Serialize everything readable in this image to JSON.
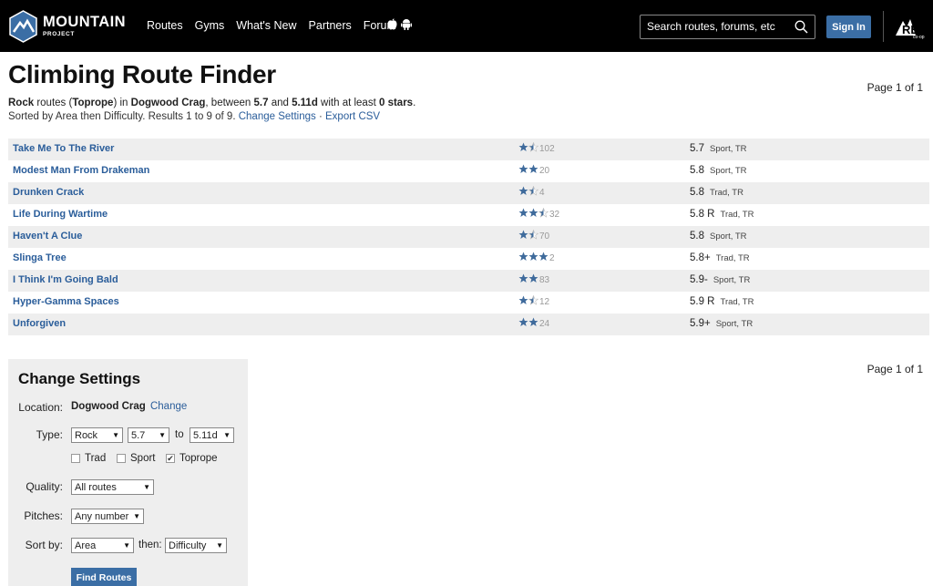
{
  "header": {
    "logo_text": "MOUNTAIN",
    "logo_subtext": "PROJECT",
    "nav": [
      "Routes",
      "Gyms",
      "What's New",
      "Partners",
      "Forum"
    ],
    "search_placeholder": "Search routes, forums, etc",
    "signin_label": "Sign In",
    "partner_logo_text": "REI",
    "partner_logo_sub": "co-op"
  },
  "page": {
    "title": "Climbing Route Finder",
    "page_count_top": "Page 1 of 1",
    "page_count_bottom": "Page 1 of 1",
    "criteria": {
      "type": "Rock",
      "t1": " routes (",
      "style": "Toprope",
      "t2": ") in ",
      "area": "Dogwood Crag",
      "t3": ", between ",
      "grade_min": "5.7",
      "t4": " and ",
      "grade_max": "5.11d",
      "t5": " with at least ",
      "stars": "0 stars",
      "t6": "."
    },
    "sort_text": "Sorted by Area then Difficulty. Results 1 to 9 of 9.",
    "change_settings_link": "Change Settings",
    "separator": "·",
    "export_link": "Export CSV"
  },
  "routes": [
    {
      "name": "Take Me To The River",
      "stars": 1.5,
      "votes": "102",
      "grade": "5.7",
      "type": "Sport, TR"
    },
    {
      "name": "Modest Man From Drakeman",
      "stars": 2,
      "votes": "20",
      "grade": "5.8",
      "type": "Sport, TR"
    },
    {
      "name": "Drunken Crack",
      "stars": 1.5,
      "votes": "4",
      "grade": "5.8",
      "type": "Trad, TR"
    },
    {
      "name": "Life During Wartime",
      "stars": 2.5,
      "votes": "32",
      "grade": "5.8 R",
      "type": "Trad, TR"
    },
    {
      "name": "Haven't A Clue",
      "stars": 1.5,
      "votes": "70",
      "grade": "5.8",
      "type": "Sport, TR"
    },
    {
      "name": "Slinga Tree",
      "stars": 3,
      "votes": "2",
      "grade": "5.8+",
      "type": "Trad, TR"
    },
    {
      "name": "I Think I'm Going Bald",
      "stars": 2,
      "votes": "83",
      "grade": "5.9-",
      "type": "Sport, TR"
    },
    {
      "name": "Hyper-Gamma Spaces",
      "stars": 1.5,
      "votes": "12",
      "grade": "5.9 R",
      "type": "Trad, TR"
    },
    {
      "name": "Unforgiven",
      "stars": 2,
      "votes": "24",
      "grade": "5.9+",
      "type": "Sport, TR"
    }
  ],
  "settings": {
    "title": "Change Settings",
    "location_label": "Location:",
    "location_value": "Dogwood Crag",
    "location_change": "Change",
    "type_label": "Type:",
    "type_value": "Rock",
    "grade_from": "5.7",
    "to_label": "to",
    "grade_to": "5.11d",
    "checkboxes": [
      {
        "label": "Trad",
        "checked": false
      },
      {
        "label": "Sport",
        "checked": false
      },
      {
        "label": "Toprope",
        "checked": true
      }
    ],
    "quality_label": "Quality:",
    "quality_value": "All routes",
    "pitches_label": "Pitches:",
    "pitches_value": "Any number",
    "sortby_label": "Sort by:",
    "sort1_value": "Area",
    "then_label": "then:",
    "sort2_value": "Difficulty",
    "find_button": "Find Routes"
  },
  "colors": {
    "link": "#2a5d9a",
    "star": "#3f6b9c",
    "button": "#3b6ea5",
    "header_bg": "#000000",
    "row_alt": "#eeeeee"
  }
}
